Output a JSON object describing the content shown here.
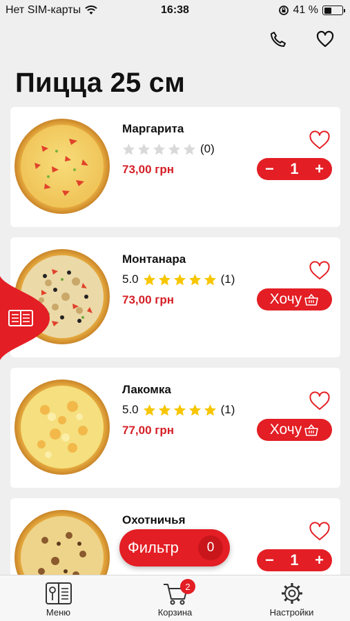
{
  "status_bar": {
    "carrier": "Нет SIM-карты",
    "time": "16:38",
    "battery": "41 %",
    "battery_level": 0.41
  },
  "header": {
    "icons": [
      "phone-icon",
      "heart-icon"
    ]
  },
  "page": {
    "title": "Пицца 25 см"
  },
  "products": [
    {
      "name": "Маргарита",
      "rating": "",
      "stars": 0,
      "reviews": "(0)",
      "price": "73,00 грн",
      "action": "stepper",
      "qty": "1"
    },
    {
      "name": "Монтанара",
      "rating": "5.0",
      "stars": 5,
      "reviews": "(1)",
      "price": "73,00 грн",
      "action": "want",
      "want_label": "Хочу"
    },
    {
      "name": "Лакомка",
      "rating": "5.0",
      "stars": 5,
      "reviews": "(1)",
      "price": "77,00 грн",
      "action": "want",
      "want_label": "Хочу"
    },
    {
      "name": "Охотничья",
      "rating": "",
      "stars": 0,
      "reviews": "",
      "price": "",
      "action": "stepper",
      "qty": "1"
    }
  ],
  "stepper": {
    "minus": "−",
    "plus": "+"
  },
  "filter": {
    "label": "Фильтр",
    "count": "0"
  },
  "tabbar": {
    "items": [
      {
        "label": "Меню",
        "icon": "menu-book-icon"
      },
      {
        "label": "Корзина",
        "icon": "cart-icon",
        "badge": "2"
      },
      {
        "label": "Настройки",
        "icon": "gear-icon"
      }
    ]
  },
  "colors": {
    "accent": "#e31e24",
    "price": "#d42027",
    "star_on": "#f7c600",
    "star_off": "#d9d9d9"
  }
}
